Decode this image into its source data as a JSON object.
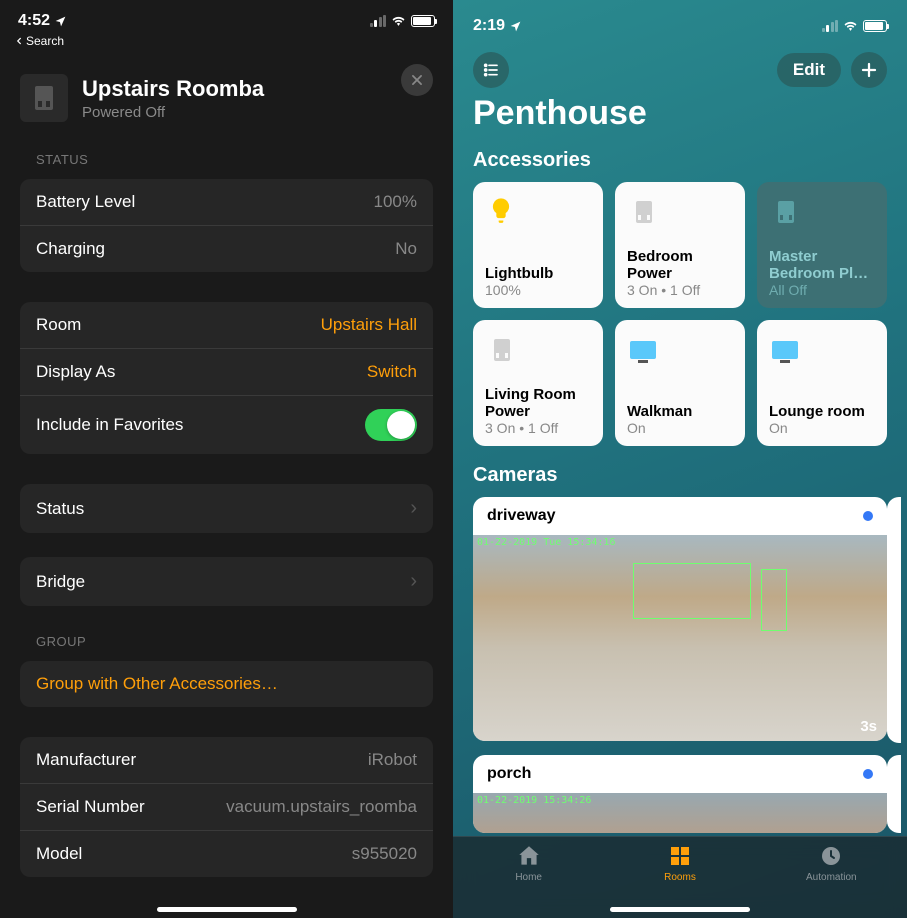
{
  "left": {
    "time": "4:52",
    "back": "Search",
    "title": "Upstairs Roomba",
    "subtitle": "Powered Off",
    "status_label": "STATUS",
    "status_rows": [
      {
        "label": "Battery Level",
        "value": "100%"
      },
      {
        "label": "Charging",
        "value": "No"
      }
    ],
    "config_rows": [
      {
        "label": "Room",
        "value": "Upstairs Hall"
      },
      {
        "label": "Display As",
        "value": "Switch"
      },
      {
        "label": "Include in Favorites"
      }
    ],
    "nav_rows": [
      {
        "label": "Status"
      },
      {
        "label": "Bridge"
      }
    ],
    "group_label": "GROUP",
    "group_action": "Group with Other Accessories…",
    "info_rows": [
      {
        "label": "Manufacturer",
        "value": "iRobot"
      },
      {
        "label": "Serial Number",
        "value": "vacuum.upstairs_roomba"
      },
      {
        "label": "Model",
        "value": "s955020"
      }
    ]
  },
  "right": {
    "time": "2:19",
    "edit": "Edit",
    "home_name": "Penthouse",
    "accessories_label": "Accessories",
    "tiles": [
      {
        "name": "Lightbulb",
        "sub": "100%",
        "icon": "bulb",
        "dark": false
      },
      {
        "name": "Bedroom Power",
        "sub": "3 On • 1 Off",
        "icon": "plug",
        "dark": false
      },
      {
        "name": "Master Bedroom Pl…",
        "sub": "All Off",
        "icon": "plug",
        "dark": true
      },
      {
        "name": "Living Room Power",
        "sub": "3 On • 1 Off",
        "icon": "plug",
        "dark": false
      },
      {
        "name": "Walkman",
        "sub": "On",
        "icon": "tv",
        "dark": false
      },
      {
        "name": "Lounge room",
        "sub": "On",
        "icon": "tv",
        "dark": false
      }
    ],
    "cameras_label": "Cameras",
    "cameras": [
      {
        "name": "driveway",
        "timestamp": "01-22-2019 Tue 15:34:16",
        "duration": "3s"
      },
      {
        "name": "porch",
        "timestamp": "01-22-2019 15:34:26"
      }
    ],
    "tabs": [
      {
        "label": "Home",
        "icon": "home"
      },
      {
        "label": "Rooms",
        "icon": "rooms"
      },
      {
        "label": "Automation",
        "icon": "clock"
      }
    ]
  }
}
